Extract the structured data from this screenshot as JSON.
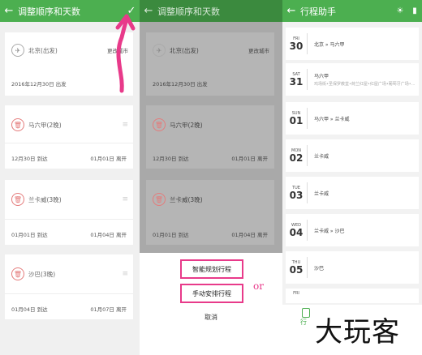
{
  "panel1": {
    "header": {
      "back": "←",
      "title": "调整顺序和天数",
      "check": "✓"
    },
    "start": {
      "city": "北京(出发)",
      "change": "更改城市",
      "date": "2016年12月30日 出发"
    },
    "stops": [
      {
        "name": "马六甲(2晚)",
        "arrive": "12月30日 到达",
        "leave": "01月01日 离开"
      },
      {
        "name": "兰卡威(3晚)",
        "arrive": "01月01日 到达",
        "leave": "01月04日 离开"
      },
      {
        "name": "沙巴(3晚)",
        "arrive": "01月04日 到达",
        "leave": "01月07日 离开"
      }
    ]
  },
  "panel2": {
    "header": {
      "back": "←",
      "title": "调整顺序和天数"
    },
    "start": {
      "city": "北京(出发)",
      "change": "更改城市",
      "date": "2016年12月30日 出发"
    },
    "stops": [
      {
        "name": "马六甲(2晚)",
        "arrive": "12月30日 到达",
        "leave": "01月01日 离开"
      },
      {
        "name": "兰卡威(3晚)",
        "arrive": "01月01日 到达",
        "leave": "01月04日 离开"
      }
    ],
    "sheet": {
      "smart": "智能规划行程",
      "manual": "手动安排行程",
      "cancel": "取消"
    },
    "or_label": "or"
  },
  "panel3": {
    "header": {
      "back": "←",
      "title": "行程助手"
    },
    "days": [
      {
        "wk": "FRI",
        "d": "30",
        "text": "北京 » 马六甲",
        "sub": ""
      },
      {
        "wk": "SAT",
        "d": "31",
        "text": "马六甲",
        "sub": "鸡场街•圣保罗教堂•荷兰红屋•红屋广场•葡萄牙广场•..."
      },
      {
        "wk": "SUN",
        "d": "01",
        "text": "马六甲 » 兰卡威",
        "sub": ""
      },
      {
        "wk": "MON",
        "d": "02",
        "text": "兰卡威",
        "sub": ""
      },
      {
        "wk": "TUE",
        "d": "03",
        "text": "兰卡威",
        "sub": ""
      },
      {
        "wk": "WED",
        "d": "04",
        "text": "兰卡威 » 沙巴",
        "sub": ""
      },
      {
        "wk": "THU",
        "d": "05",
        "text": "沙巴",
        "sub": ""
      },
      {
        "wk": "FRI",
        "d": "",
        "text": "",
        "sub": ""
      }
    ],
    "bottom_tab": "行"
  },
  "watermark": "大玩客",
  "colors": {
    "header_green": "#4caf50",
    "highlight_pink": "#e83a8a"
  }
}
